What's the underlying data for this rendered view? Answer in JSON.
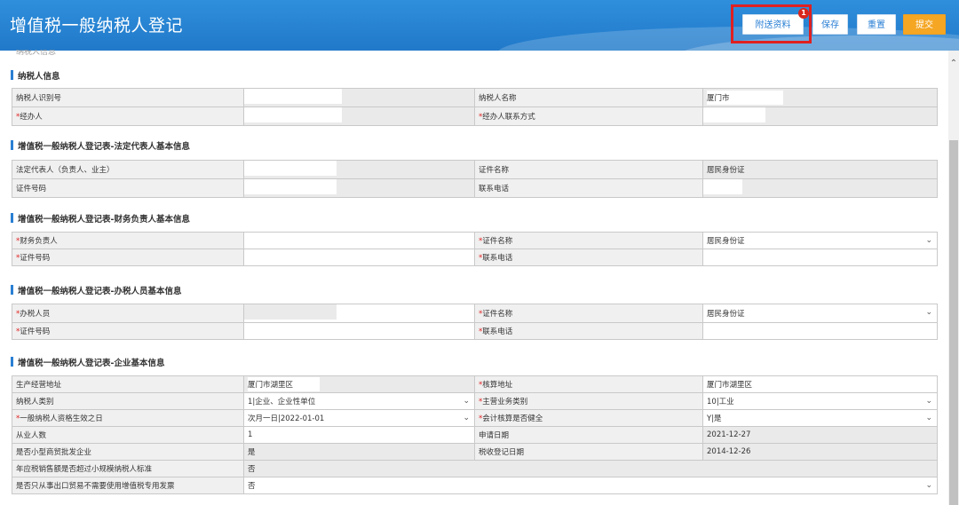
{
  "header": {
    "title": "增值税一般纳税人登记",
    "buttons": {
      "attach": "附送资料",
      "save": "保存",
      "reset": "重置",
      "submit": "提交"
    },
    "badge_count": "1"
  },
  "cut_text": "纳税人信息",
  "sections": {
    "s1": {
      "title": "纳税人信息",
      "rows": [
        {
          "l1": "纳税人识别号",
          "v1": "",
          "l2": "纳税人名称",
          "v2": "厦门市"
        },
        {
          "l1": "经办人",
          "v1": "",
          "l2": "经办人联系方式",
          "v2": ""
        }
      ]
    },
    "s2": {
      "title": "增值税一般纳税人登记表-法定代表人基本信息",
      "rows": [
        {
          "l1": "法定代表人（负责人、业主）",
          "v1": "",
          "l2": "证件名称",
          "v2": "居民身份证"
        },
        {
          "l1": "证件号码",
          "v1": "",
          "l2": "联系电话",
          "v2": ""
        }
      ]
    },
    "s3": {
      "title": "增值税一般纳税人登记表-财务负责人基本信息",
      "rows": [
        {
          "l1": "财务负责人",
          "v1": "",
          "l2": "证件名称",
          "v2": "居民身份证"
        },
        {
          "l1": "证件号码",
          "v1": "",
          "l2": "联系电话",
          "v2": ""
        }
      ]
    },
    "s4": {
      "title": "增值税一般纳税人登记表-办税人员基本信息",
      "rows": [
        {
          "l1": "办税人员",
          "v1": "",
          "l2": "证件名称",
          "v2": "居民身份证"
        },
        {
          "l1": "证件号码",
          "v1": "",
          "l2": "联系电话",
          "v2": ""
        }
      ]
    },
    "s5": {
      "title": "增值税一般纳税人登记表-企业基本信息",
      "rows": [
        {
          "l1": "生产经营地址",
          "v1": "厦门市湖里区",
          "l2": "核算地址",
          "v2": "厦门市湖里区"
        },
        {
          "l1": "纳税人类别",
          "v1": "1|企业、企业性单位",
          "l2": "主营业务类别",
          "v2": "10|工业"
        },
        {
          "l1": "一般纳税人资格生效之日",
          "v1": "次月一日|2022-01-01",
          "l2": "会计核算是否健全",
          "v2": "Y|是"
        },
        {
          "l1": "从业人数",
          "v1": "1",
          "l2": "申请日期",
          "v2": "2021-12-27"
        },
        {
          "l1": "是否小型商贸批发企业",
          "v1": "是",
          "l2": "税收登记日期",
          "v2": "2014-12-26"
        },
        {
          "l1": "年应税销售额是否超过小规模纳税人标准",
          "v1": "否"
        },
        {
          "l1": "是否只从事出口贸易不需要使用增值税专用发票",
          "v1": "否"
        }
      ]
    }
  },
  "colors": {
    "header": "#2179c9",
    "submit": "#f5a623",
    "highlight": "#e02020"
  }
}
